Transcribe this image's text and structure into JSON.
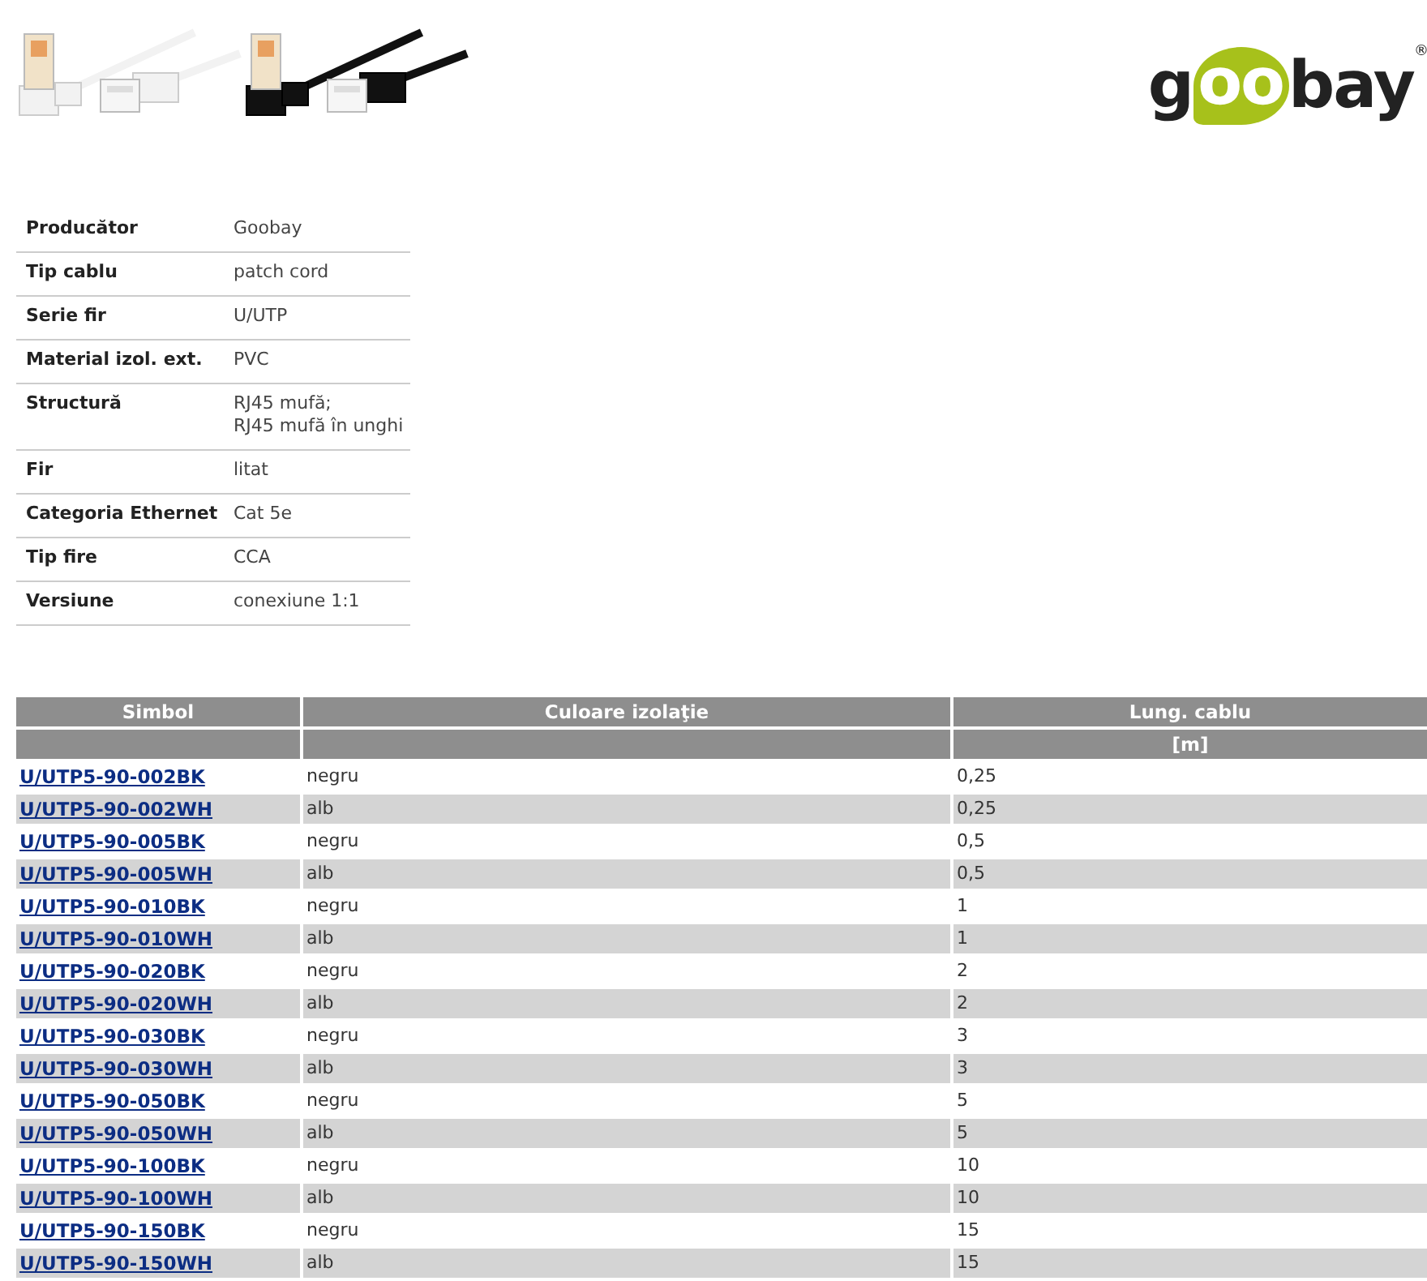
{
  "logo": {
    "parts": [
      "g",
      "oo",
      "bay"
    ],
    "mark": "®"
  },
  "specs": [
    {
      "label": "Producător",
      "value": "Goobay"
    },
    {
      "label": "Tip cablu",
      "value": "patch cord"
    },
    {
      "label": "Serie fir",
      "value": "U/UTP"
    },
    {
      "label": "Material izol. ext.",
      "value": "PVC"
    },
    {
      "label": "Structură",
      "value": "RJ45 mufă;\nRJ45 mufă în unghi"
    },
    {
      "label": "Fir",
      "value": "litat"
    },
    {
      "label": "Categoria Ethernet",
      "value": "Cat 5e"
    },
    {
      "label": "Tip fire",
      "value": "CCA"
    },
    {
      "label": "Versiune",
      "value": "conexiune 1:1"
    }
  ],
  "table": {
    "columns": [
      {
        "label": "Simbol"
      },
      {
        "label": "Culoare izolaţie"
      },
      {
        "label": "Lung. cablu",
        "unit": "[m]"
      }
    ],
    "rows": [
      {
        "symbol": "U/UTP5-90-002BK",
        "insulation": "negru",
        "length": "0,25"
      },
      {
        "symbol": "U/UTP5-90-002WH",
        "insulation": "alb",
        "length": "0,25"
      },
      {
        "symbol": "U/UTP5-90-005BK",
        "insulation": "negru",
        "length": "0,5"
      },
      {
        "symbol": "U/UTP5-90-005WH",
        "insulation": "alb",
        "length": "0,5"
      },
      {
        "symbol": "U/UTP5-90-010BK",
        "insulation": "negru",
        "length": "1"
      },
      {
        "symbol": "U/UTP5-90-010WH",
        "insulation": "alb",
        "length": "1"
      },
      {
        "symbol": "U/UTP5-90-020BK",
        "insulation": "negru",
        "length": "2"
      },
      {
        "symbol": "U/UTP5-90-020WH",
        "insulation": "alb",
        "length": "2"
      },
      {
        "symbol": "U/UTP5-90-030BK",
        "insulation": "negru",
        "length": "3"
      },
      {
        "symbol": "U/UTP5-90-030WH",
        "insulation": "alb",
        "length": "3"
      },
      {
        "symbol": "U/UTP5-90-050BK",
        "insulation": "negru",
        "length": "5"
      },
      {
        "symbol": "U/UTP5-90-050WH",
        "insulation": "alb",
        "length": "5"
      },
      {
        "symbol": "U/UTP5-90-100BK",
        "insulation": "negru",
        "length": "10"
      },
      {
        "symbol": "U/UTP5-90-100WH",
        "insulation": "alb",
        "length": "10"
      },
      {
        "symbol": "U/UTP5-90-150BK",
        "insulation": "negru",
        "length": "15"
      },
      {
        "symbol": "U/UTP5-90-150WH",
        "insulation": "alb",
        "length": "15"
      }
    ]
  }
}
